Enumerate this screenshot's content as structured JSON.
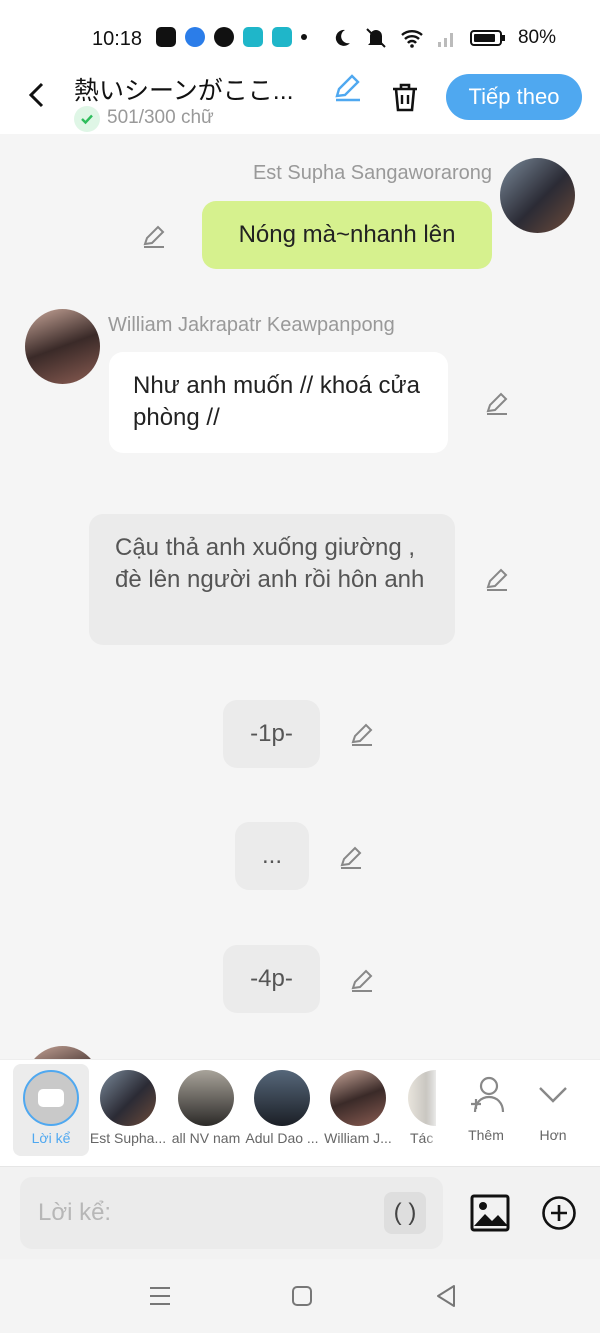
{
  "status_bar": {
    "time": "10:18",
    "battery": "80%"
  },
  "header": {
    "title": "熱いシーンがここ...",
    "word_count": "501/300 chữ",
    "next_label": "Tiếp theo",
    "accent_color": "#4fa8f0"
  },
  "messages": [
    {
      "sender": "Est Supha Sangaworarong",
      "text": "Nóng mà~nhanh lên",
      "side": "right",
      "style": "green"
    },
    {
      "sender": "William Jakrapatr Keawpanpong",
      "text": "Như anh muốn // khoá cửa phòng //",
      "side": "left",
      "style": "white"
    },
    {
      "sender": "",
      "text": "Cậu thả anh xuống giường , đè lên người anh rồi hôn anh",
      "style": "narration"
    },
    {
      "sender": "",
      "text": "-1p-",
      "style": "narration"
    },
    {
      "sender": "",
      "text": "...",
      "style": "narration"
    },
    {
      "sender": "",
      "text": "-4p-",
      "style": "narration"
    }
  ],
  "characters": [
    {
      "label": "Lời kể",
      "selected": true
    },
    {
      "label": "Est Supha..."
    },
    {
      "label": "all NV nam"
    },
    {
      "label": "Adul Dao ..."
    },
    {
      "label": "William J..."
    },
    {
      "label": "Tác"
    }
  ],
  "actions": {
    "add_label": "Thêm",
    "more_label": "Hơn"
  },
  "input": {
    "placeholder": "Lời kể:",
    "paren_button": "( )"
  }
}
